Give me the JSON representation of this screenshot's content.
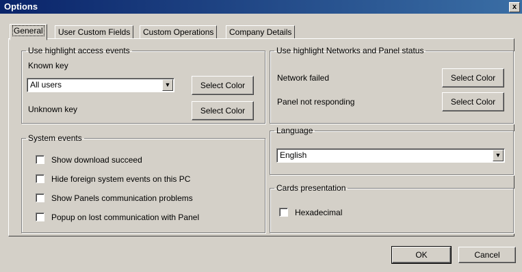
{
  "window": {
    "title": "Options",
    "close_glyph": "x"
  },
  "tabs": [
    {
      "label": "General",
      "active": true
    },
    {
      "label": "User Custom Fields"
    },
    {
      "label": "Custom Operations"
    },
    {
      "label": "Company Details"
    }
  ],
  "access_events": {
    "legend": "Use highlight access events",
    "known_key_label": "Known key",
    "users_combo_value": "All users",
    "unknown_key_label": "Unknown key",
    "select_color_label": "Select Color"
  },
  "system_events": {
    "legend": "System events",
    "items": [
      {
        "label": "Show download succeed",
        "checked": false
      },
      {
        "label": "Hide foreign system events on this PC",
        "checked": false
      },
      {
        "label": "Show Panels communication problems",
        "checked": false
      },
      {
        "label": "Popup on lost communication with Panel",
        "checked": false
      }
    ]
  },
  "network_status": {
    "legend": "Use highlight Networks and Panel status",
    "network_failed_label": "Network failed",
    "panel_not_responding_label": "Panel not responding",
    "select_color_label": "Select Color"
  },
  "language": {
    "legend": "Language",
    "value": "English"
  },
  "cards": {
    "legend": "Cards presentation",
    "hexadecimal_label": "Hexadecimal",
    "hexadecimal_checked": false
  },
  "footer": {
    "ok_label": "OK",
    "cancel_label": "Cancel"
  }
}
